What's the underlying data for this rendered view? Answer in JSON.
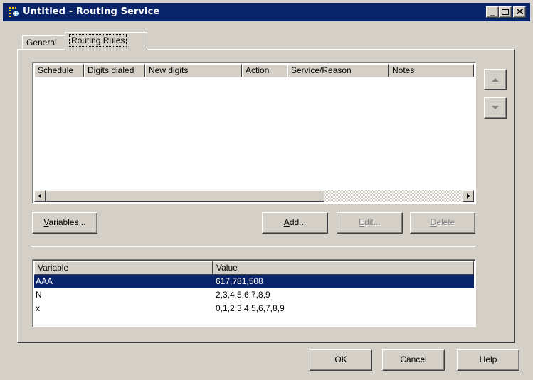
{
  "window": {
    "title": "Untitled - Routing Service",
    "controls": [
      "_",
      "□",
      "✕"
    ]
  },
  "tabs": [
    {
      "label": "General",
      "active": false
    },
    {
      "label": "Routing Rules",
      "active": true
    }
  ],
  "rules_table": {
    "columns": [
      "Schedule",
      "Digits dialed",
      "New digits",
      "Action",
      "Service/Reason",
      "Notes"
    ],
    "rows": []
  },
  "buttons": {
    "variables": {
      "pre": "",
      "mn": "V",
      "post": "ariables..."
    },
    "add": {
      "pre": "",
      "mn": "A",
      "post": "dd..."
    },
    "edit": {
      "pre": "",
      "mn": "E",
      "post": "dit..."
    },
    "delete": {
      "pre": "",
      "mn": "D",
      "post": "elete"
    },
    "ok": "OK",
    "cancel": "Cancel",
    "help": "Help"
  },
  "variables_table": {
    "columns": [
      "Variable",
      "Value"
    ],
    "rows": [
      {
        "variable": "AAA",
        "value": "617,781,508",
        "selected": true
      },
      {
        "variable": "N",
        "value": "2,3,4,5,6,7,8,9",
        "selected": false
      },
      {
        "variable": "x",
        "value": "0,1,2,3,4,5,6,7,8,9",
        "selected": false
      }
    ]
  },
  "colors": {
    "titlebar": "#0a246a",
    "selection": "#0a246a",
    "face": "#d4d0c8"
  }
}
